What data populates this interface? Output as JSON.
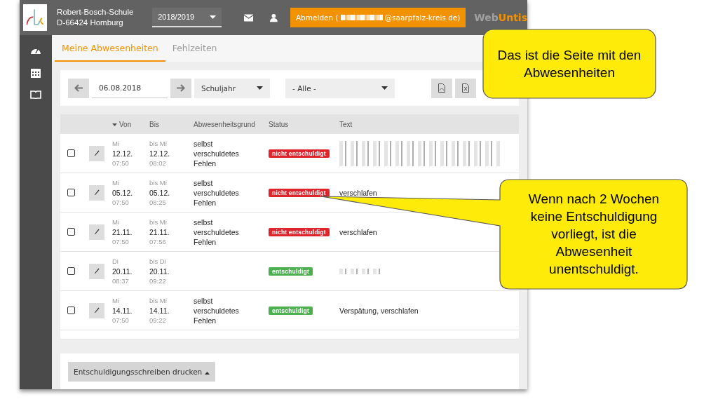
{
  "header": {
    "school_name": "Robert-Bosch-Schule",
    "school_address": "D-66424 Homburg",
    "school_year": "2018/2019",
    "logout_prefix": "Abmelden (",
    "logout_suffix": "@saarpfalz-kreis.de)",
    "brand": [
      "Web",
      "Untis"
    ]
  },
  "tabs": [
    {
      "label": "Meine Abwesenheiten",
      "selected": true
    },
    {
      "label": "Fehlzeiten",
      "selected": false
    }
  ],
  "filters": {
    "date": "06.08.2018",
    "period": "Schuljahr",
    "status": "- Alle -"
  },
  "table": {
    "columns": [
      "Von",
      "Bis",
      "Abwesenheitsgrund",
      "Status",
      "Text"
    ],
    "rows": [
      {
        "checked": false,
        "from_day": "Mi",
        "from_date": "12.12.",
        "from_time": "07:50",
        "to_day": "bis Mi",
        "to_date": "12.12.",
        "to_time": "08:02",
        "reason": "selbst verschuldetes Fehlen",
        "status": {
          "kind": "unexcused",
          "label": "nicht entschuldigt"
        },
        "text_redacted": true
      },
      {
        "checked": false,
        "from_day": "Mi",
        "from_date": "05.12.",
        "from_time": "07:50",
        "to_day": "bis Mi",
        "to_date": "05.12.",
        "to_time": "08:25",
        "reason": "selbst verschuldetes Fehlen",
        "status": {
          "kind": "unexcused",
          "label": "nicht entschuldigt"
        },
        "text": "verschlafen"
      },
      {
        "checked": false,
        "from_day": "Mi",
        "from_date": "21.11.",
        "from_time": "07:50",
        "to_day": "bis Mi",
        "to_date": "21.11.",
        "to_time": "07:56",
        "reason": "selbst verschuldetes Fehlen",
        "status": {
          "kind": "unexcused",
          "label": "nicht entschuldigt"
        },
        "text": "verschlafen"
      },
      {
        "checked": false,
        "from_day": "Di",
        "from_date": "20.11.",
        "from_time": "08:37",
        "to_day": "bis Di",
        "to_date": "20.11.",
        "to_time": "09:22",
        "status": {
          "kind": "excused",
          "label": "entschuldigt"
        },
        "text_redacted": true
      },
      {
        "checked": false,
        "from_day": "Mi",
        "from_date": "14.11.",
        "from_time": "07:50",
        "to_day": "bis Mi",
        "to_date": "14.11.",
        "to_time": "09:22",
        "reason": "selbst verschuldetes Fehlen",
        "status": {
          "kind": "excused",
          "label": "entschuldigt"
        },
        "text": "Verspätung, verschlafen"
      }
    ]
  },
  "print_button": "Entschuldigungsschreiben drucken",
  "callouts": [
    "Das ist die Seite mit den Abwesenheiten",
    "Wenn nach 2 Wochen keine Entschuldigung vorliegt, ist die Abwesenheit unentschuldigt."
  ]
}
